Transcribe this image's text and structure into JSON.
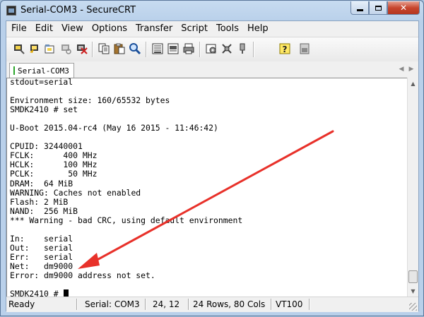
{
  "window": {
    "title": "Serial-COM3 - SecureCRT",
    "minimize_label": "",
    "maximize_label": "",
    "close_label": "✕"
  },
  "menu": [
    "File",
    "Edit",
    "View",
    "Options",
    "Transfer",
    "Script",
    "Tools",
    "Help"
  ],
  "toolbar": {
    "icons": [
      "connect-icon",
      "quick-connect-icon",
      "connect-in-tab-icon",
      "reconnect-icon",
      "disconnect-icon",
      "copy-icon",
      "paste-icon",
      "find-icon",
      "print-icon",
      "print-selection-icon",
      "printer-icon",
      "session-options-icon",
      "global-options-icon",
      "keymap-icon",
      "help-icon",
      "about-icon"
    ]
  },
  "tab": {
    "label": "Serial-COM3",
    "status_color": "#2aa52a"
  },
  "terminal": {
    "lines": [
      "stdout=serial",
      "",
      "Environment size: 160/65532 bytes",
      "SMDK2410 # set",
      "",
      "U-Boot 2015.04-rc4 (May 16 2015 - 11:46:42)",
      "",
      "CPUID: 32440001",
      "FCLK:      400 MHz",
      "HCLK:      100 MHz",
      "PCLK:       50 MHz",
      "DRAM:  64 MiB",
      "WARNING: Caches not enabled",
      "Flash: 2 MiB",
      "NAND:  256 MiB",
      "*** Warning - bad CRC, using default environment",
      "",
      "In:    serial",
      "Out:   serial",
      "Err:   serial",
      "Net:   dm9000",
      "Error: dm9000 address not set.",
      "",
      "SMDK2410 # "
    ],
    "annotation_color": "#e8312a"
  },
  "statusbar": {
    "ready": "Ready",
    "connection": "Serial: COM3",
    "position": "24,  12",
    "size": "24 Rows,  80 Cols",
    "emulation": "VT100"
  }
}
